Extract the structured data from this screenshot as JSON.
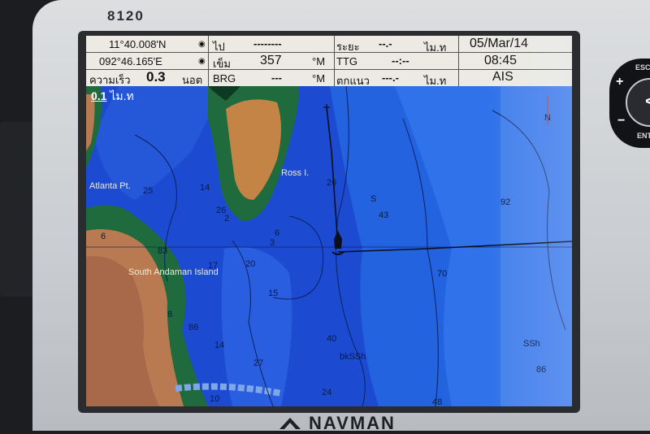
{
  "device": {
    "model": "8120",
    "brand": "NAVMAN"
  },
  "header": {
    "lat": "11°40.008'N",
    "lon": "092°46.165'E",
    "speed_label": "ความเร็ว",
    "speed_value": "0.3",
    "speed_unit": "นอต",
    "heading_label": "ไป",
    "heading_value": "--------",
    "course_label": "เข็ม",
    "course_value": "357",
    "course_unit": "°M",
    "brg_label": "BRG",
    "brg_value": "---",
    "brg_unit": "°M",
    "dist_label": "ระยะ",
    "dist_value": "--.-",
    "dist_unit": "ไม.ท",
    "ttg_label": "TTG",
    "ttg_value": "--:--",
    "xte_label": "ตกแนว",
    "xte_value": "---.-",
    "xte_unit": "ไม.ท",
    "date": "05/Mar/14",
    "time": "08:45",
    "ais": "AIS"
  },
  "map": {
    "scale_value": "0.1",
    "scale_unit": "ไม.ท",
    "north": "N",
    "places": [
      "Ross I.",
      "Atlanta Pt.",
      "South Andaman Island"
    ],
    "depths": [
      "25",
      "14",
      "26",
      "6",
      "83",
      "17",
      "20",
      "2",
      "3",
      "26",
      "6",
      "S",
      "43",
      "92",
      "70",
      "15",
      "8",
      "86",
      "14",
      "40",
      "bkSSh",
      "27",
      "24",
      "SSh",
      "86",
      "48",
      "10"
    ]
  },
  "controls": {
    "plus": "+",
    "minus": "−",
    "back": "<",
    "esc": "ESC",
    "ent": "ENT"
  }
}
